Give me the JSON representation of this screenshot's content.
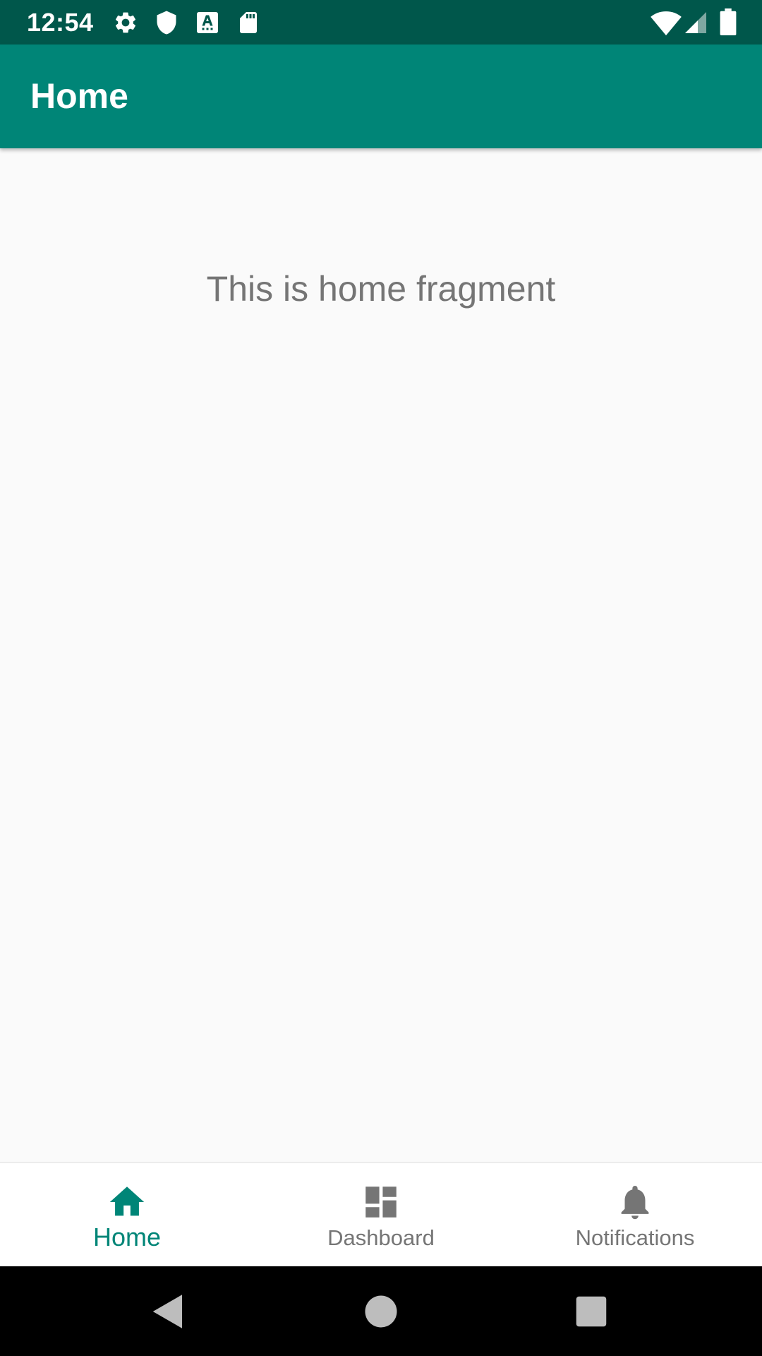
{
  "status_bar": {
    "time": "12:54",
    "background": "#00574b",
    "left_icons": [
      "settings-icon",
      "shield-icon",
      "keyboard-a-icon",
      "sd-card-icon"
    ],
    "right_icons": [
      "wifi-icon",
      "cell-signal-icon",
      "battery-icon"
    ]
  },
  "app_bar": {
    "title": "Home",
    "background": "#008577"
  },
  "main": {
    "text": "This is home fragment"
  },
  "bottom_nav": {
    "items": [
      {
        "label": "Home",
        "icon": "home-icon",
        "active": true
      },
      {
        "label": "Dashboard",
        "icon": "dashboard-icon",
        "active": false
      },
      {
        "label": "Notifications",
        "icon": "bell-icon",
        "active": false
      }
    ],
    "active_color": "#008577",
    "inactive_color": "#757575"
  },
  "system_nav": {
    "buttons": [
      "back-icon",
      "home-circle-icon",
      "recents-icon"
    ]
  }
}
